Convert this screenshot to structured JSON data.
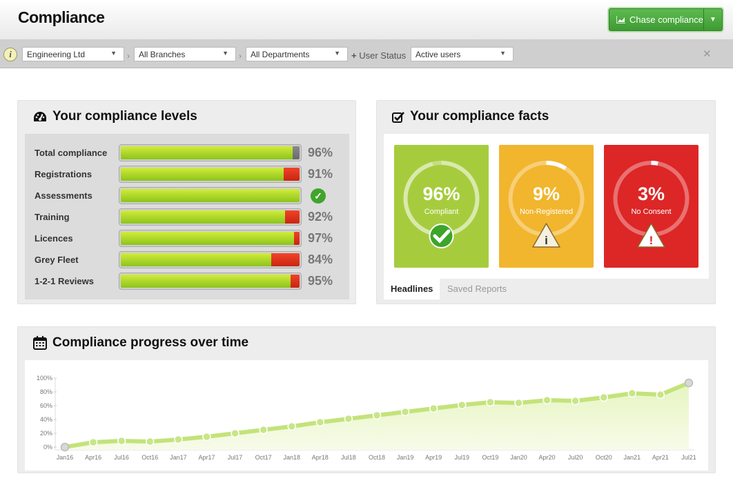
{
  "header": {
    "title": "Compliance",
    "chase_button": "Chase compliance"
  },
  "filters": {
    "company": "Engineering Ltd",
    "branch": "All Branches",
    "department": "All Departments",
    "user_status_label": "User Status",
    "user_status": "Active users"
  },
  "levels": {
    "title": "Your compliance levels",
    "rows": [
      {
        "label": "Total compliance",
        "fill": 0.96,
        "remainder": "grey",
        "pct": "96%"
      },
      {
        "label": "Registrations",
        "fill": 0.91,
        "remainder": "red",
        "pct": "91%"
      },
      {
        "label": "Assessments",
        "fill": 1.0,
        "remainder": "none",
        "pct": "",
        "complete": true
      },
      {
        "label": "Training",
        "fill": 0.92,
        "remainder": "red",
        "pct": "92%"
      },
      {
        "label": "Licences",
        "fill": 0.97,
        "remainder": "red",
        "pct": "97%"
      },
      {
        "label": "Grey Fleet",
        "fill": 0.84,
        "remainder": "red",
        "pct": "84%"
      },
      {
        "label": "1-2-1 Reviews",
        "fill": 0.95,
        "remainder": "red",
        "pct": "95%"
      }
    ]
  },
  "facts": {
    "title": "Your compliance facts",
    "cards": [
      {
        "pct": "96%",
        "label": "Compliant",
        "level": 0.96,
        "color": "#a6cc3e",
        "icon": "check-badge-icon"
      },
      {
        "pct": "9%",
        "label": "Non-Registered",
        "level": 0.09,
        "color": "#f2b52e",
        "icon": "info-warning-icon"
      },
      {
        "pct": "3%",
        "label": "No Consent",
        "level": 0.03,
        "color": "#dd2626",
        "icon": "alert-warning-icon"
      }
    ],
    "tabs": [
      "Headlines",
      "Saved Reports"
    ]
  },
  "progress": {
    "title": "Compliance progress over time"
  },
  "chart_data": {
    "type": "area",
    "title": "Compliance progress over time",
    "x": [
      "Jan16",
      "Apr16",
      "Jul16",
      "Oct16",
      "Jan17",
      "Apr17",
      "Jul17",
      "Oct17",
      "Jan18",
      "Apr18",
      "Jul18",
      "Oct18",
      "Jan19",
      "Apr19",
      "Jul19",
      "Oct19",
      "Jan20",
      "Apr20",
      "Jul20",
      "Oct20",
      "Jan21",
      "Apr21",
      "Jul21"
    ],
    "y": [
      0,
      7,
      9,
      8,
      11,
      15,
      20,
      25,
      30,
      36,
      41,
      46,
      51,
      56,
      61,
      65,
      64,
      68,
      67,
      72,
      78,
      76,
      93
    ],
    "yticks": [
      "0%",
      "20%",
      "40%",
      "60%",
      "80%",
      "100%"
    ],
    "ylim": [
      0,
      100
    ],
    "color": "#c3e37a",
    "grid": false
  }
}
